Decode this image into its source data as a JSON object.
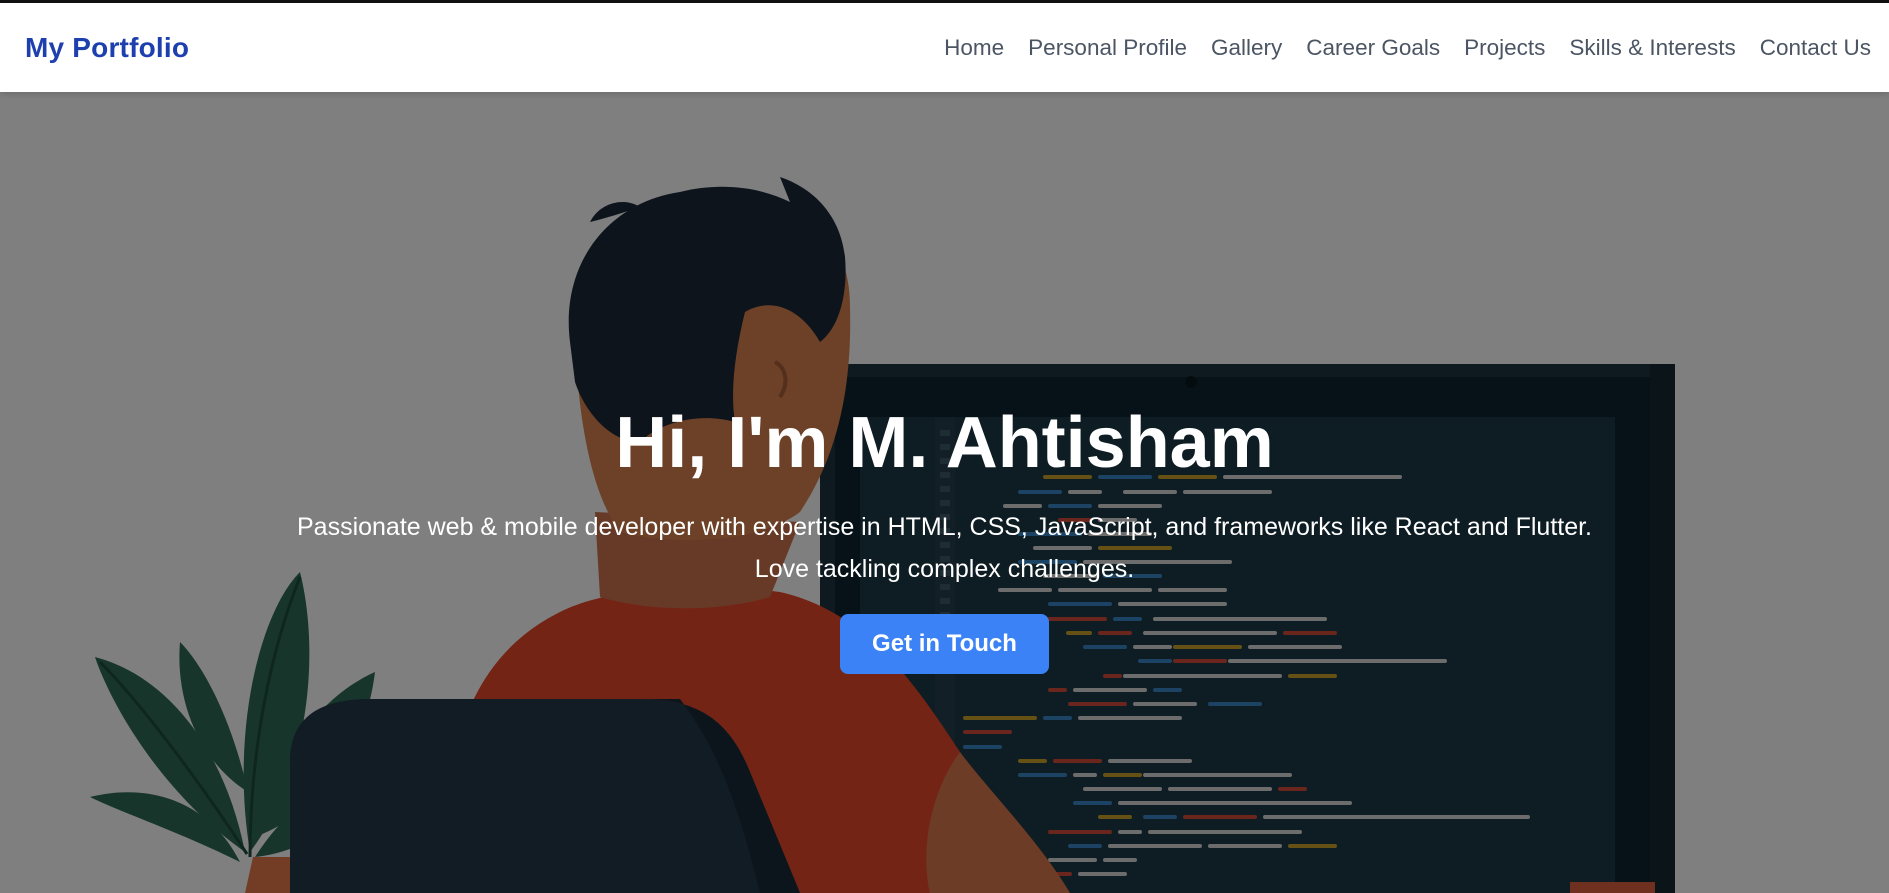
{
  "brand": {
    "name": "My Portfolio"
  },
  "nav": {
    "links": [
      {
        "label": "Home"
      },
      {
        "label": "Personal Profile"
      },
      {
        "label": "Gallery"
      },
      {
        "label": "Career Goals"
      },
      {
        "label": "Projects"
      },
      {
        "label": "Skills & Interests"
      },
      {
        "label": "Contact Us"
      }
    ]
  },
  "hero": {
    "title": "Hi, I'm M. Ahtisham",
    "description_line1": "Passionate web & mobile developer with expertise in HTML, CSS, JavaScript, and frameworks like React and Flutter.",
    "description_line2": "Love tackling complex challenges.",
    "cta_label": "Get in Touch"
  },
  "colors": {
    "brand": "#1e40af",
    "nav_text": "#4b5563",
    "cta": "#3b82f6",
    "overlay": "#808080"
  },
  "icons": {
    "background": "developer-at-computer-illustration"
  }
}
